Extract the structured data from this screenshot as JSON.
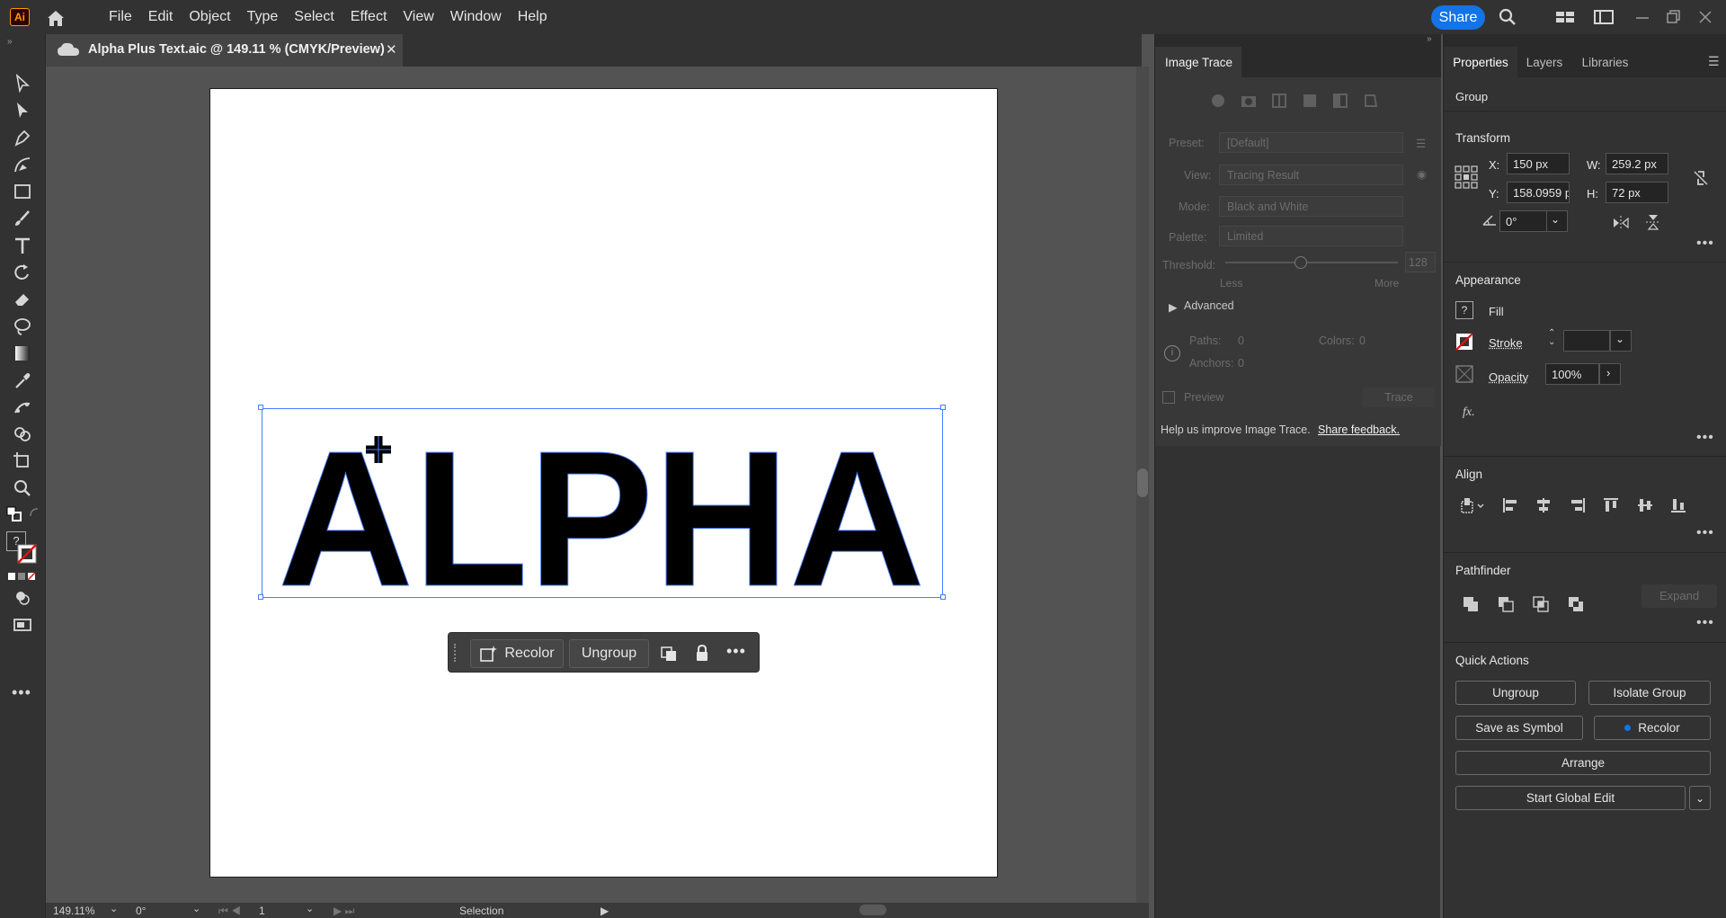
{
  "app": {
    "logo": "Ai",
    "share_label": "Share"
  },
  "menu": [
    "File",
    "Edit",
    "Object",
    "Type",
    "Select",
    "Effect",
    "View",
    "Window",
    "Help"
  ],
  "document": {
    "tab_title": "Alpha Plus Text.aic @ 149.11 % (CMYK/Preview)",
    "artwork_text": "ALPHA"
  },
  "context_bar": {
    "recolor_label": "Recolor",
    "ungroup_label": "Ungroup"
  },
  "status": {
    "zoom": "149.11%",
    "rotation": "0°",
    "artboard": "1",
    "tool": "Selection"
  },
  "image_trace": {
    "tab": "Image Trace",
    "preset_label": "Preset:",
    "preset_value": "[Default]",
    "view_label": "View:",
    "view_value": "Tracing Result",
    "mode_label": "Mode:",
    "mode_value": "Black and White",
    "palette_label": "Palette:",
    "palette_value": "Limited",
    "threshold_label": "Threshold:",
    "threshold_value": "128",
    "less_label": "Less",
    "more_label": "More",
    "advanced_label": "Advanced",
    "paths_label": "Paths:",
    "paths_value": "0",
    "colors_label": "Colors:",
    "colors_value": "0",
    "anchors_label": "Anchors:",
    "anchors_value": "0",
    "preview_label": "Preview",
    "trace_label": "Trace",
    "help_text": "Help us improve Image Trace.",
    "feedback_link": "Share feedback."
  },
  "properties": {
    "tabs": [
      "Properties",
      "Layers",
      "Libraries"
    ],
    "selection_type": "Group",
    "transform": {
      "title": "Transform",
      "x_label": "X:",
      "x": "150 px",
      "y_label": "Y:",
      "y": "158.0959 p",
      "w_label": "W:",
      "w": "259.2 px",
      "h_label": "H:",
      "h": "72 px",
      "angle": "0°"
    },
    "appearance": {
      "title": "Appearance",
      "fill_label": "Fill",
      "stroke_label": "Stroke",
      "opacity_label": "Opacity",
      "opacity_value": "100%",
      "fx_label": "fx."
    },
    "align": {
      "title": "Align"
    },
    "pathfinder": {
      "title": "Pathfinder",
      "expand_label": "Expand"
    },
    "quick_actions": {
      "title": "Quick Actions",
      "ungroup": "Ungroup",
      "isolate": "Isolate Group",
      "save_symbol": "Save as Symbol",
      "recolor": "Recolor",
      "arrange": "Arrange",
      "global_edit": "Start Global Edit"
    }
  },
  "colors": {
    "accent": "#1473e6",
    "selection": "#4a7cff",
    "panel": "#323232",
    "canvas": "#535353"
  }
}
